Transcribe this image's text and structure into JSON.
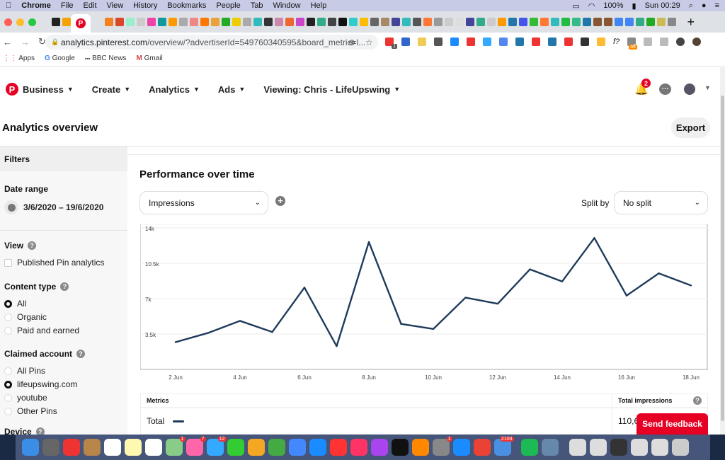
{
  "menubar": {
    "app": "Chrome",
    "items": [
      "File",
      "Edit",
      "View",
      "History",
      "Bookmarks",
      "People",
      "Tab",
      "Window",
      "Help"
    ],
    "battery": "100%",
    "clock": "Sun 00:29"
  },
  "tabs": {
    "favicon_colors": [
      "#222",
      "#f4a300",
      "#e60023",
      "#f48120",
      "#d9472b",
      "#9ec",
      "#ccc",
      "#e4a",
      "#11999e",
      "#f90",
      "#aaa",
      "#e88",
      "#f70",
      "#e9a23b",
      "#2a2",
      "#ec0",
      "#aaa",
      "#3bb",
      "#333",
      "#c8a",
      "#e63",
      "#c4c",
      "#222",
      "#3a8",
      "#444",
      "#111",
      "#3cc",
      "#fb0",
      "#666",
      "#a86",
      "#449",
      "#3bb",
      "#555",
      "#f73",
      "#999",
      "#ccc",
      "#ddd",
      "#449",
      "#3a8",
      "#ccc",
      "#f90",
      "#27a",
      "#45e",
      "#3b3",
      "#f73",
      "#3bb",
      "#2b4",
      "#3b8",
      "#27a",
      "#853",
      "#853",
      "#4285f4",
      "#4285f4",
      "#3a8",
      "#2a2",
      "#cb5",
      "#888"
    ],
    "new_tab": "+"
  },
  "address": {
    "url_host": "analytics.pinterest.com",
    "url_path": "/overview/?advertiserId=549760340595&board_metric=l...",
    "ext_badge": "1",
    "ext_off": "off",
    "ext_f": "f?"
  },
  "bookmarks": [
    {
      "label": "Apps",
      "icon": "grid-icon"
    },
    {
      "label": "Google",
      "icon": "google-icon"
    },
    {
      "label": "BBC News",
      "icon": "bbc-icon"
    },
    {
      "label": "Gmail",
      "icon": "gmail-icon"
    }
  ],
  "nav": {
    "brand_color": "#e60023",
    "items": [
      "Business",
      "Create",
      "Analytics",
      "Ads",
      "Viewing: Chris - LifeUpswing"
    ],
    "notif_count": "2"
  },
  "page": {
    "title": "Analytics overview",
    "export": "Export"
  },
  "sidebar": {
    "filters": "Filters",
    "date_range_label": "Date range",
    "date_range": "3/6/2020 – 19/6/2020",
    "view_label": "View",
    "view_option": "Published Pin analytics",
    "content_type_label": "Content type",
    "content_types": [
      {
        "label": "All",
        "selected": true
      },
      {
        "label": "Organic",
        "selected": false
      },
      {
        "label": "Paid and earned",
        "selected": false
      }
    ],
    "claimed_label": "Claimed account",
    "claimed": [
      {
        "label": "All Pins",
        "selected": false
      },
      {
        "label": "lifeupswing.com",
        "selected": true
      },
      {
        "label": "youtube",
        "selected": false
      },
      {
        "label": "Other Pins",
        "selected": false
      }
    ],
    "device_label": "Device"
  },
  "main": {
    "section_title": "Performance over time",
    "metric_select": "Impressions",
    "split_label": "Split by",
    "split_select": "No split"
  },
  "chart_data": {
    "type": "line",
    "x": [
      "2 Jun",
      "3 Jun",
      "4 Jun",
      "5 Jun",
      "6 Jun",
      "7 Jun",
      "8 Jun",
      "9 Jun",
      "10 Jun",
      "11 Jun",
      "12 Jun",
      "13 Jun",
      "14 Jun",
      "15 Jun",
      "16 Jun",
      "17 Jun",
      "18 Jun"
    ],
    "values": [
      2700,
      3600,
      4800,
      3700,
      8100,
      2300,
      12600,
      4500,
      4000,
      7100,
      6500,
      9900,
      8700,
      13000,
      7300,
      9500,
      8300
    ],
    "xticks": [
      "2 Jun",
      "4 Jun",
      "6 Jun",
      "8 Jun",
      "10 Jun",
      "12 Jun",
      "14 Jun",
      "16 Jun",
      "18 Jun"
    ],
    "yticks": [
      "3.5k",
      "7k",
      "10.5k",
      "14k"
    ],
    "ytick_values": [
      3500,
      7000,
      10500,
      14000
    ],
    "ylim": [
      0,
      14000
    ],
    "grid": true,
    "line_color": "#1f3b5b"
  },
  "metrics": {
    "col1": "Metrics",
    "col2": "Total impressions",
    "row_label": "Total",
    "row_value": "110,6"
  },
  "feedback": "Send feedback",
  "dock": {
    "icon_colors": [
      "#3a8ee6",
      "#666",
      "#e33",
      "#b8864a",
      "#fff",
      "#fff8b0",
      "#fff",
      "#8c8",
      "#f6a",
      "#3af",
      "#3c3",
      "#f5a623",
      "#4a4",
      "#48f",
      "#1a8cff",
      "#f33",
      "#f36",
      "#a4e",
      "#111",
      "#f80",
      "#888",
      "#1a8cff",
      "#ea4335",
      "#4a90e2",
      "#1db954",
      "#68a",
      "#ddd",
      "#ddd",
      "#333",
      "#ddd",
      "#ddd",
      "#ccc"
    ],
    "badges": {
      "7": "1",
      "8": "7",
      "9": "12",
      "20": "1",
      "23": "2104"
    }
  }
}
